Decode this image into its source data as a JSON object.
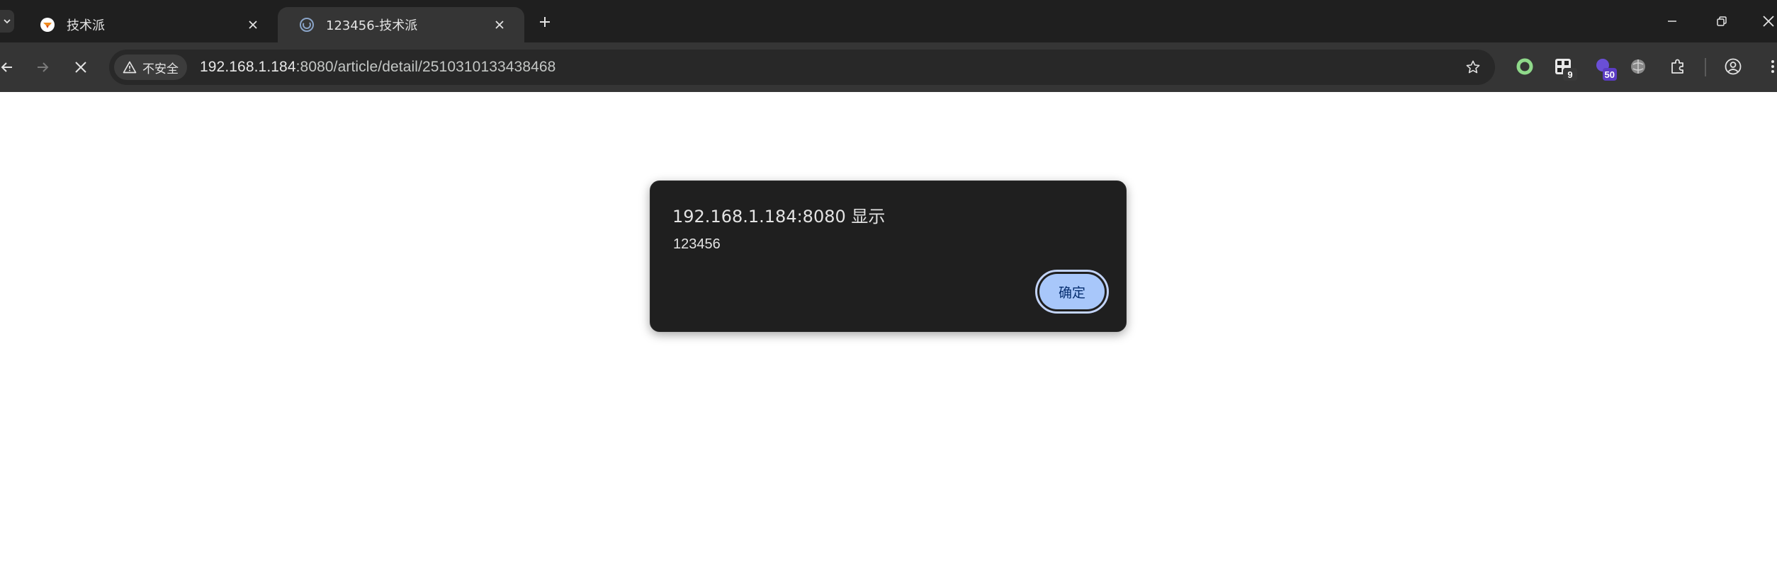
{
  "tabs": [
    {
      "title": "技术派",
      "active": false,
      "favicon": "orange-logo-icon"
    },
    {
      "title": "123456-技术派",
      "active": true,
      "favicon": "loading-globe-icon"
    }
  ],
  "toolbar": {
    "security_chip_label": "不安全",
    "url_host": "192.168.1.184",
    "url_rest": ":8080/article/detail/2510310133438468"
  },
  "extensions": [
    {
      "name": "green-ring-extension-icon",
      "badge": ""
    },
    {
      "name": "qr-extension-icon",
      "badge": "9"
    },
    {
      "name": "purple-extension-icon",
      "badge": "50"
    },
    {
      "name": "gray-ball-extension-icon",
      "badge": ""
    }
  ],
  "dialog": {
    "title": "192.168.1.184:8080 显示",
    "message": "123456",
    "ok_label": "确定"
  },
  "colors": {
    "tabstrip_bg": "#1f1f1f",
    "toolbar_bg": "#353535",
    "dialog_bg": "#1f1f1f",
    "ok_button_bg": "#a8c7fa",
    "badge_purple": "#5b3cc4"
  }
}
